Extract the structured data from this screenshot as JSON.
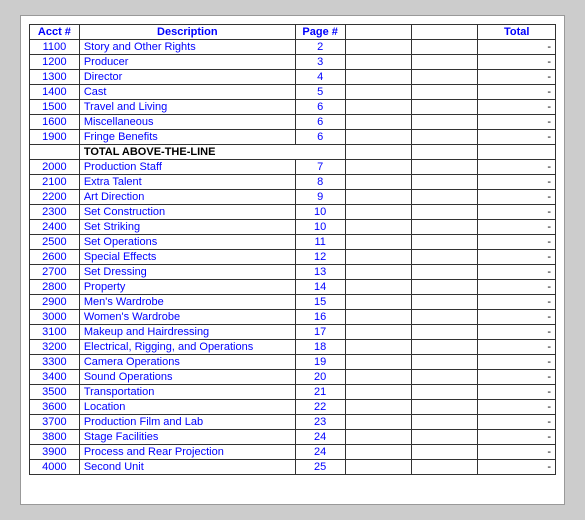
{
  "table": {
    "headers": [
      "Acct #",
      "Description",
      "Page #",
      "",
      "",
      "Total"
    ],
    "rows": [
      {
        "acct": "1100",
        "desc": "Story and Other Rights",
        "page": "2",
        "e1": "",
        "e2": "",
        "total": "-"
      },
      {
        "acct": "1200",
        "desc": "Producer",
        "page": "3",
        "e1": "",
        "e2": "",
        "total": "-"
      },
      {
        "acct": "1300",
        "desc": "Director",
        "page": "4",
        "e1": "",
        "e2": "",
        "total": "-"
      },
      {
        "acct": "1400",
        "desc": "Cast",
        "page": "5",
        "e1": "",
        "e2": "",
        "total": "-"
      },
      {
        "acct": "1500",
        "desc": "Travel and Living",
        "page": "6",
        "e1": "",
        "e2": "",
        "total": "-"
      },
      {
        "acct": "1600",
        "desc": "Miscellaneous",
        "page": "6",
        "e1": "",
        "e2": "",
        "total": "-"
      },
      {
        "acct": "1900",
        "desc": "Fringe Benefits",
        "page": "6",
        "e1": "",
        "e2": "",
        "total": "-"
      },
      {
        "acct": "",
        "desc": "TOTAL ABOVE-THE-LINE",
        "page": "",
        "e1": "",
        "e2": "",
        "total": ""
      },
      {
        "acct": "2000",
        "desc": "Production Staff",
        "page": "7",
        "e1": "",
        "e2": "",
        "total": "-"
      },
      {
        "acct": "2100",
        "desc": "Extra Talent",
        "page": "8",
        "e1": "",
        "e2": "",
        "total": "-"
      },
      {
        "acct": "2200",
        "desc": "Art Direction",
        "page": "9",
        "e1": "",
        "e2": "",
        "total": "-"
      },
      {
        "acct": "2300",
        "desc": "Set Construction",
        "page": "10",
        "e1": "",
        "e2": "",
        "total": "-"
      },
      {
        "acct": "2400",
        "desc": "Set Striking",
        "page": "10",
        "e1": "",
        "e2": "",
        "total": "-"
      },
      {
        "acct": "2500",
        "desc": "Set Operations",
        "page": "11",
        "e1": "",
        "e2": "",
        "total": "-"
      },
      {
        "acct": "2600",
        "desc": "Special Effects",
        "page": "12",
        "e1": "",
        "e2": "",
        "total": "-"
      },
      {
        "acct": "2700",
        "desc": "Set Dressing",
        "page": "13",
        "e1": "",
        "e2": "",
        "total": "-"
      },
      {
        "acct": "2800",
        "desc": "Property",
        "page": "14",
        "e1": "",
        "e2": "",
        "total": "-"
      },
      {
        "acct": "2900",
        "desc": "Men's Wardrobe",
        "page": "15",
        "e1": "",
        "e2": "",
        "total": "-"
      },
      {
        "acct": "3000",
        "desc": "Women's Wardrobe",
        "page": "16",
        "e1": "",
        "e2": "",
        "total": "-"
      },
      {
        "acct": "3100",
        "desc": "Makeup and Hairdressing",
        "page": "17",
        "e1": "",
        "e2": "",
        "total": "-"
      },
      {
        "acct": "3200",
        "desc": "Electrical, Rigging, and Operations",
        "page": "18",
        "e1": "",
        "e2": "",
        "total": "-"
      },
      {
        "acct": "3300",
        "desc": "Camera Operations",
        "page": "19",
        "e1": "",
        "e2": "",
        "total": "-"
      },
      {
        "acct": "3400",
        "desc": "Sound Operations",
        "page": "20",
        "e1": "",
        "e2": "",
        "total": "-"
      },
      {
        "acct": "3500",
        "desc": "Transportation",
        "page": "21",
        "e1": "",
        "e2": "",
        "total": "-"
      },
      {
        "acct": "3600",
        "desc": "Location",
        "page": "22",
        "e1": "",
        "e2": "",
        "total": "-"
      },
      {
        "acct": "3700",
        "desc": "Production Film and Lab",
        "page": "23",
        "e1": "",
        "e2": "",
        "total": "-"
      },
      {
        "acct": "3800",
        "desc": "Stage Facilities",
        "page": "24",
        "e1": "",
        "e2": "",
        "total": "-"
      },
      {
        "acct": "3900",
        "desc": "Process and Rear Projection",
        "page": "24",
        "e1": "",
        "e2": "",
        "total": "-"
      },
      {
        "acct": "4000",
        "desc": "Second Unit",
        "page": "25",
        "e1": "",
        "e2": "",
        "total": "-"
      }
    ]
  }
}
